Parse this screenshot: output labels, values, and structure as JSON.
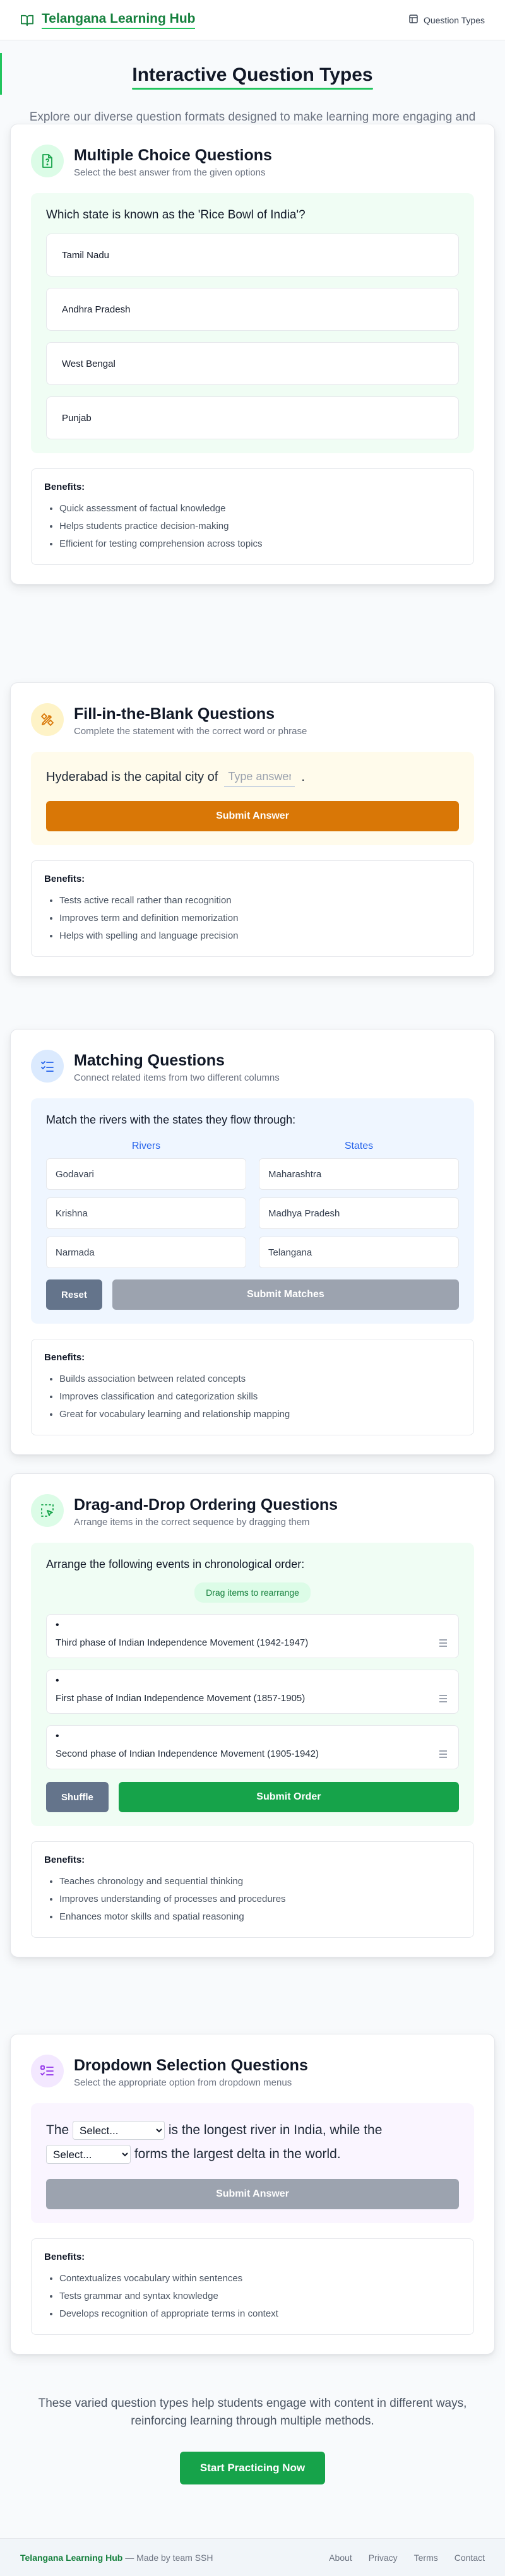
{
  "header": {
    "brand": "Telangana Learning Hub",
    "nav_label": "Question Types"
  },
  "hero": {
    "title": "Interactive Question Types",
    "subtitle": "Explore our diverse question formats designed to make learning more engaging and effective"
  },
  "benefits_label": "Benefits:",
  "mcq": {
    "title": "Multiple Choice Questions",
    "desc": "Select the best answer from the given options",
    "question": "Which state is known as the 'Rice Bowl of India'?",
    "options": [
      "Tamil Nadu",
      "Andhra Pradesh",
      "West Bengal",
      "Punjab"
    ],
    "benefits": [
      "Quick assessment of factual knowledge",
      "Helps students practice decision-making",
      "Efficient for testing comprehension across topics"
    ]
  },
  "fib": {
    "title": "Fill-in-the-Blank Questions",
    "desc": "Complete the statement with the correct word or phrase",
    "prefix": "Hyderabad is the capital city of",
    "suffix": ".",
    "placeholder": "Type answer",
    "submit": "Submit Answer",
    "benefits": [
      "Tests active recall rather than recognition",
      "Improves term and definition memorization",
      "Helps with spelling and language precision"
    ]
  },
  "matching": {
    "title": "Matching Questions",
    "desc": "Connect related items from two different columns",
    "prompt": "Match the rivers with the states they flow through:",
    "left_header": "Rivers",
    "right_header": "States",
    "left": [
      "Godavari",
      "Krishna",
      "Narmada"
    ],
    "right": [
      "Maharashtra",
      "Madhya Pradesh",
      "Telangana"
    ],
    "reset": "Reset",
    "submit": "Submit Matches",
    "benefits": [
      "Builds association between related concepts",
      "Improves classification and categorization skills",
      "Great for vocabulary learning and relationship mapping"
    ]
  },
  "dragdrop": {
    "title": "Drag-and-Drop Ordering Questions",
    "desc": "Arrange items in the correct sequence by dragging them",
    "prompt": "Arrange the following events in chronological order:",
    "hint": "Drag items to rearrange",
    "items": [
      "Third phase of Indian Independence Movement (1942-1947)",
      "First phase of Indian Independence Movement (1857-1905)",
      "Second phase of Indian Independence Movement (1905-1942)"
    ],
    "shuffle": "Shuffle",
    "submit": "Submit Order",
    "benefits": [
      "Teaches chronology and sequential thinking",
      "Improves understanding of processes and procedures",
      "Enhances motor skills and spatial reasoning"
    ]
  },
  "dropdown": {
    "title": "Dropdown Selection Questions",
    "desc": "Select the appropriate option from dropdown menus",
    "part1": "The",
    "part2": "is the longest river in India, while the",
    "part3": "forms the largest delta in the world.",
    "select_placeholder": "Select...",
    "submit": "Submit Answer",
    "benefits": [
      "Contextualizes vocabulary within sentences",
      "Tests grammar and syntax knowledge",
      "Develops recognition of appropriate terms in context"
    ]
  },
  "closing": {
    "text": "These varied question types help students engage with content in different ways, reinforcing learning through multiple methods.",
    "cta": "Start Practicing Now"
  },
  "footer": {
    "brand": "Telangana Learning Hub",
    "made_by": " — Made by team SSH",
    "links": [
      "About",
      "Privacy",
      "Terms",
      "Contact"
    ]
  },
  "colors": {
    "brand_green": "#15803d",
    "accent_green": "#22c55e",
    "orange": "#d97706",
    "blue": "#2563eb",
    "purple": "#9333ea"
  }
}
